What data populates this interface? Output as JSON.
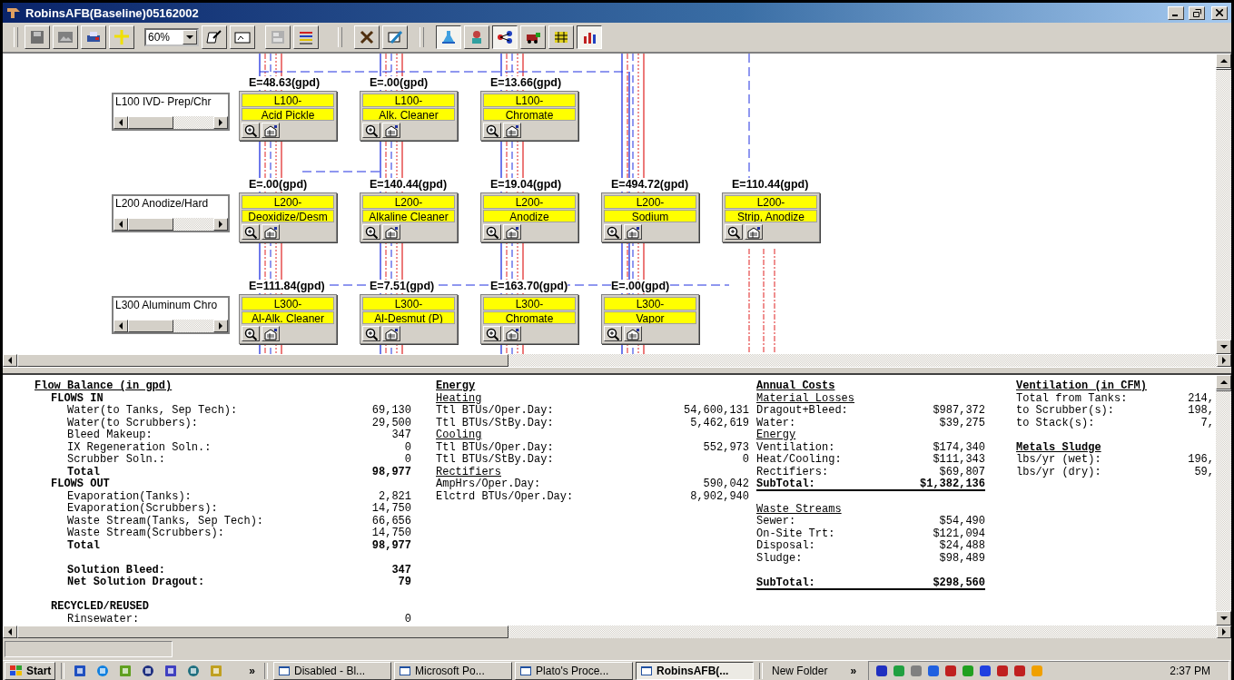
{
  "window": {
    "title": "RobinsAFB(Baseline)05162002"
  },
  "toolbar": {
    "zoom": "60%",
    "toggles": [
      {
        "pressed": true
      },
      {
        "pressed": false
      },
      {
        "pressed": true
      },
      {
        "pressed": false
      },
      {
        "pressed": false
      },
      {
        "pressed": true
      }
    ]
  },
  "diagram": {
    "rows": [
      {
        "label": "L100 IVD- Prep/Chr",
        "tanks": [
          {
            "flow": "E=48.63(gpd)",
            "line": "L100-",
            "name": "Acid Pickle"
          },
          {
            "flow": "E=.00(gpd)",
            "line": "L100-",
            "name": "Alk. Cleaner"
          },
          {
            "flow": "E=13.66(gpd)",
            "line": "L100-",
            "name": "Chromate"
          }
        ]
      },
      {
        "label": "L200 Anodize/Hard",
        "tanks": [
          {
            "flow": "E=.00(gpd)",
            "line": "L200-",
            "name": "Deoxidize/Desm"
          },
          {
            "flow": "E=140.44(gpd)",
            "line": "L200-",
            "name": "Alkaline Cleaner"
          },
          {
            "flow": "E=19.04(gpd)",
            "line": "L200-",
            "name": "Anodize"
          },
          {
            "flow": "E=494.72(gpd)",
            "line": "L200-",
            "name": "Sodium"
          },
          {
            "flow": "E=110.44(gpd)",
            "line": "L200-",
            "name": "Strip, Anodize"
          }
        ]
      },
      {
        "label": "L300 Aluminum Chro",
        "tanks": [
          {
            "flow": "E=111.84(gpd)",
            "line": "L300-",
            "name": "Al-Alk. Cleaner"
          },
          {
            "flow": "E=7.51(gpd)",
            "line": "L300-",
            "name": "Al-Desmut (P)"
          },
          {
            "flow": "E=163.70(gpd)",
            "line": "L300-",
            "name": "Chromate"
          },
          {
            "flow": "E=.00(gpd)",
            "line": "L300-",
            "name": "Vapor"
          }
        ]
      }
    ]
  },
  "report": {
    "sections": [
      {
        "title": "Flow Balance (in gpd)",
        "lines": [
          {
            "kind": "group",
            "text": "FLOWS IN",
            "children": [
              {
                "kind": "row",
                "label": "Water(to Tanks, Sep Tech):",
                "value": "69,130"
              },
              {
                "kind": "row",
                "label": "Water(to Scrubbers):",
                "value": "29,500"
              },
              {
                "kind": "row",
                "label": "Bleed Makeup:",
                "value": "347"
              },
              {
                "kind": "row",
                "label": "IX Regeneration Soln.:",
                "value": "0"
              },
              {
                "kind": "row",
                "label": "Scrubber Soln.:",
                "value": "0"
              },
              {
                "kind": "total",
                "label": "Total",
                "value": "98,977"
              }
            ]
          },
          {
            "kind": "group",
            "text": "FLOWS OUT",
            "children": [
              {
                "kind": "row",
                "label": "Evaporation(Tanks):",
                "value": "2,821"
              },
              {
                "kind": "row",
                "label": "Evaporation(Scrubbers):",
                "value": "14,750"
              },
              {
                "kind": "row",
                "label": "Waste Stream(Tanks, Sep Tech):",
                "value": "66,656"
              },
              {
                "kind": "row",
                "label": "Waste Stream(Scrubbers):",
                "value": "14,750"
              },
              {
                "kind": "total",
                "label": "Total",
                "value": "98,977"
              },
              {
                "kind": "total",
                "label": "Solution Bleed:",
                "value": "347",
                "space_before": true
              },
              {
                "kind": "total",
                "label": "Net Solution Dragout:",
                "value": "79"
              }
            ]
          },
          {
            "kind": "group",
            "text": "RECYCLED/REUSED",
            "space_before": true,
            "children": [
              {
                "kind": "row",
                "label": "Rinsewater:",
                "value": "0"
              }
            ]
          }
        ]
      },
      {
        "title": "Energy",
        "lines": [
          {
            "kind": "sub",
            "text": "Heating"
          },
          {
            "kind": "row",
            "label": "Ttl BTUs/Oper.Day:",
            "value": "54,600,131"
          },
          {
            "kind": "row",
            "label": "Ttl BTUs/StBy.Day:",
            "value": "5,462,619"
          },
          {
            "kind": "sub",
            "text": "Cooling"
          },
          {
            "kind": "row",
            "label": "Ttl BTUs/Oper.Day:",
            "value": "552,973"
          },
          {
            "kind": "row",
            "label": "Ttl BTUs/StBy.Day:",
            "value": "0"
          },
          {
            "kind": "sub",
            "text": "Rectifiers"
          },
          {
            "kind": "row",
            "label": "AmpHrs/Oper.Day:",
            "value": "590,042"
          },
          {
            "kind": "row",
            "label": "Elctrd BTUs/Oper.Day:",
            "value": "8,902,940"
          }
        ]
      },
      {
        "title": "Annual Costs",
        "lines": [
          {
            "kind": "sub",
            "text": "Material Losses"
          },
          {
            "kind": "row",
            "label": "Dragout+Bleed:",
            "value": "$987,372"
          },
          {
            "kind": "row",
            "label": "Water:",
            "value": "$39,275"
          },
          {
            "kind": "sub",
            "text": "Energy"
          },
          {
            "kind": "row",
            "label": "Ventilation:",
            "value": "$174,340"
          },
          {
            "kind": "row",
            "label": "Heat/Cooling:",
            "value": "$111,343"
          },
          {
            "kind": "row",
            "label": "Rectifiers:",
            "value": "$69,807"
          },
          {
            "kind": "subtotal",
            "label": "SubTotal:",
            "value": "$1,382,136"
          },
          {
            "kind": "sub",
            "text": "Waste Streams",
            "space_before": true
          },
          {
            "kind": "row",
            "label": "Sewer:",
            "value": "$54,490"
          },
          {
            "kind": "row",
            "label": "On-Site Trt:",
            "value": "$121,094"
          },
          {
            "kind": "row",
            "label": "Disposal:",
            "value": "$24,488"
          },
          {
            "kind": "row",
            "label": "Sludge:",
            "value": "$98,489"
          },
          {
            "kind": "subtotal",
            "label": "SubTotal:",
            "value": "$298,560",
            "space_before": true
          }
        ]
      },
      {
        "title": "Ventilation (in CFM)",
        "lines": [
          {
            "kind": "row",
            "label": "Total from Tanks:",
            "value": "214,"
          },
          {
            "kind": "row",
            "label": "to Scrubber(s):",
            "value": "198,"
          },
          {
            "kind": "row",
            "label": "to Stack(s):",
            "value": "7,"
          },
          {
            "kind": "heading",
            "text": "Metals Sludge",
            "space_before": true
          },
          {
            "kind": "row",
            "label": "lbs/yr (wet):",
            "value": "196,"
          },
          {
            "kind": "row",
            "label": "lbs/yr (dry):",
            "value": "59,"
          }
        ]
      }
    ]
  },
  "taskbar": {
    "start": "Start",
    "launch_more": "»",
    "tasks": [
      {
        "label": "Disabled - Bl...",
        "selected": false
      },
      {
        "label": "Microsoft Po...",
        "selected": false
      },
      {
        "label": "Plato's Proce...",
        "selected": false
      },
      {
        "label": "RobinsAFB(...",
        "selected": true
      }
    ],
    "folder": "New Folder",
    "folder_more": "»",
    "clock": "2:37 PM"
  }
}
